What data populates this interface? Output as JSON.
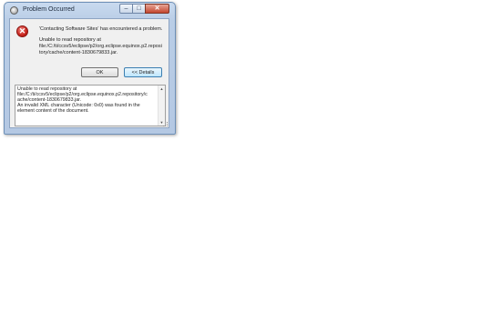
{
  "window": {
    "title": "Problem Occurred",
    "minimize_glyph": "‒",
    "maximize_glyph": "□",
    "close_glyph": "✕"
  },
  "dialog": {
    "error_icon_glyph": "✕",
    "headline": "'Contacting Software Sites' has encountered a problem.",
    "message_lines": [
      "Unable to read repository at",
      "file:/C:/ti/ccsv5/eclipse/p2/org.eclipse.equinox.p2.reposi",
      "tory/cache/content-1830679833.jar."
    ],
    "ok_label": "OK",
    "details_label": "<< Details"
  },
  "details": {
    "lines": [
      "Unable to read repository at",
      "file:/C:/ti/ccsv5/eclipse/p2/org.eclipse.equinox.p2.repository/c",
      "ache/content-1830679833.jar.",
      "  An invalid XML character (Unicode: 0x0) was found in the",
      "element content of the document."
    ],
    "scroll_up_glyph": "▲",
    "scroll_down_glyph": "▼"
  },
  "colors": {
    "title_bar": "#c9daef",
    "close_button": "#c4462e",
    "error_icon": "#c8241c",
    "details_button_border": "#3c7fb1"
  },
  "icons": [
    "app-icon",
    "error-icon",
    "minimize-icon",
    "maximize-icon",
    "close-icon",
    "scroll-up-icon",
    "scroll-down-icon"
  ]
}
